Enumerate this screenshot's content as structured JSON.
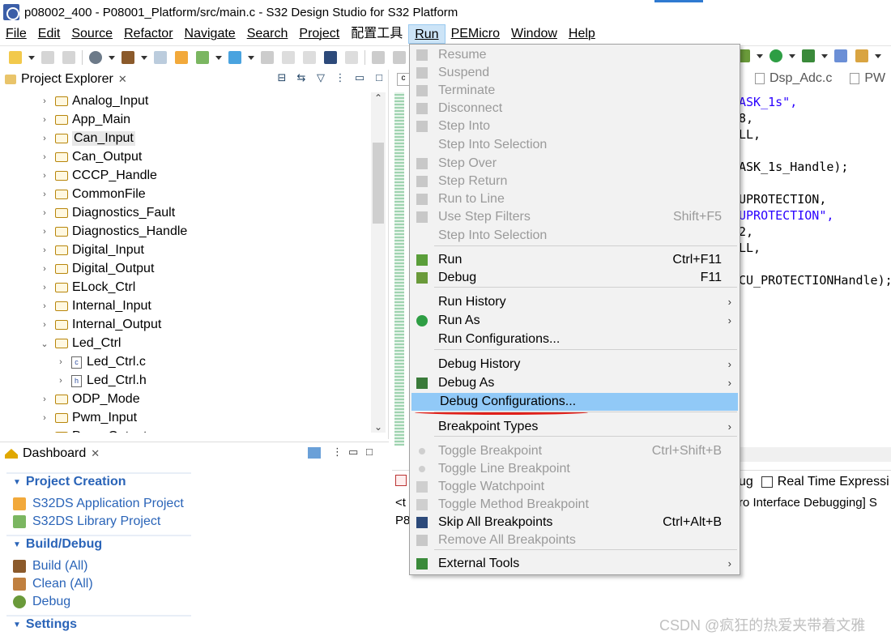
{
  "window": {
    "title": "p08002_400 - P08001_Platform/src/main.c - S32 Design Studio for S32 Platform"
  },
  "menubar": [
    "File",
    "Edit",
    "Source",
    "Refactor",
    "Navigate",
    "Search",
    "Project",
    "配置工具",
    "Run",
    "PEMicro",
    "Window",
    "Help"
  ],
  "project_explorer": {
    "title": "Project Explorer",
    "close": "✕",
    "items": [
      {
        "label": "Analog_Input",
        "type": "folder",
        "expanded": false
      },
      {
        "label": "App_Main",
        "type": "folder",
        "expanded": false
      },
      {
        "label": "Can_Input",
        "type": "folder",
        "expanded": false,
        "selected": true
      },
      {
        "label": "Can_Output",
        "type": "folder",
        "expanded": false
      },
      {
        "label": "CCCP_Handle",
        "type": "folder",
        "expanded": false
      },
      {
        "label": "CommonFile",
        "type": "folder",
        "expanded": false
      },
      {
        "label": "Diagnostics_Fault",
        "type": "folder",
        "expanded": false
      },
      {
        "label": "Diagnostics_Handle",
        "type": "folder",
        "expanded": false
      },
      {
        "label": "Digital_Input",
        "type": "folder",
        "expanded": false
      },
      {
        "label": "Digital_Output",
        "type": "folder",
        "expanded": false
      },
      {
        "label": "ELock_Ctrl",
        "type": "folder",
        "expanded": false
      },
      {
        "label": "Internal_Input",
        "type": "folder",
        "expanded": false
      },
      {
        "label": "Internal_Output",
        "type": "folder",
        "expanded": false
      },
      {
        "label": "Led_Ctrl",
        "type": "folder",
        "expanded": true
      },
      {
        "label": "Led_Ctrl.c",
        "type": "file-c",
        "child": true
      },
      {
        "label": "Led_Ctrl.h",
        "type": "file-h",
        "child": true
      },
      {
        "label": "ODP_Mode",
        "type": "folder",
        "expanded": false
      },
      {
        "label": "Pwm_Input",
        "type": "folder",
        "expanded": false
      },
      {
        "label": "Pwm_Output",
        "type": "folder",
        "expanded": false
      }
    ]
  },
  "dashboard": {
    "title": "Dashboard",
    "close": "✕",
    "sections": [
      {
        "title": "Project Creation",
        "links": [
          "S32DS Application Project",
          "S32DS Library Project"
        ]
      },
      {
        "title": "Build/Debug",
        "links": [
          "Build  (All)",
          "Clean  (All)",
          "Debug"
        ]
      },
      {
        "title": "Settings",
        "links": []
      }
    ]
  },
  "editor": {
    "tabs_right": [
      "Dsp_Adc.c",
      "PW"
    ],
    "code_lines": [
      {
        "text": "ASK_1s\",",
        "str": true
      },
      {
        "text": "8,",
        "str": false
      },
      {
        "text": "LL,",
        "str": false
      },
      {
        "text": "",
        "str": false
      },
      {
        "text": "ASK_1s_Handle);",
        "str": false
      },
      {
        "text": "",
        "str": false
      },
      {
        "text": "UPROTECTION,",
        "str": false
      },
      {
        "text": "UPROTECTION\",",
        "str": true
      },
      {
        "text": "2,",
        "str": false
      },
      {
        "text": "LL,",
        "str": false
      },
      {
        "text": "",
        "str": false
      },
      {
        "text": "CU_PROTECTIONHandle);",
        "str": false
      }
    ]
  },
  "console": {
    "tab_fragment": "ug",
    "tab_real_time": "Real Time Expressi",
    "line1_left": "<t",
    "line1_right": "ro Interface Debugging] S",
    "line2": "P8"
  },
  "run_menu": {
    "items": [
      {
        "label": "Resume",
        "accel": "",
        "disabled": true,
        "icon": "resume-icon"
      },
      {
        "label": "Suspend",
        "accel": "",
        "disabled": true,
        "icon": "suspend-icon"
      },
      {
        "label": "Terminate",
        "accel": "",
        "disabled": true,
        "icon": "terminate-icon"
      },
      {
        "label": "Disconnect",
        "accel": "",
        "disabled": true,
        "icon": "disconnect-icon"
      },
      {
        "label": "Step Into",
        "accel": "",
        "disabled": true,
        "icon": "step-into-icon"
      },
      {
        "label": "Step Into Selection",
        "accel": "",
        "disabled": true,
        "icon": ""
      },
      {
        "label": "Step Over",
        "accel": "",
        "disabled": true,
        "icon": "step-over-icon"
      },
      {
        "label": "Step Return",
        "accel": "",
        "disabled": true,
        "icon": "step-return-icon"
      },
      {
        "label": "Run to Line",
        "accel": "",
        "disabled": true,
        "icon": "run-to-line-icon"
      },
      {
        "label": "Use Step Filters",
        "accel": "Shift+F5",
        "disabled": true,
        "icon": "step-filters-icon"
      },
      {
        "label": "Step Into Selection",
        "accel": "",
        "disabled": true,
        "icon": ""
      },
      {
        "label": "Run",
        "accel": "Ctrl+F11",
        "disabled": false,
        "icon": "run-icon"
      },
      {
        "label": "Debug",
        "accel": "F11",
        "disabled": false,
        "icon": "debug-icon"
      },
      {
        "label": "Run History",
        "accel": "",
        "disabled": false,
        "icon": "",
        "submenu": true
      },
      {
        "label": "Run As",
        "accel": "",
        "disabled": false,
        "icon": "run-as-icon",
        "submenu": true
      },
      {
        "label": "Run Configurations...",
        "accel": "",
        "disabled": false,
        "icon": ""
      },
      {
        "label": "Debug History",
        "accel": "",
        "disabled": false,
        "icon": "",
        "submenu": true
      },
      {
        "label": "Debug As",
        "accel": "",
        "disabled": false,
        "icon": "debug-as-icon",
        "submenu": true
      },
      {
        "label": "Debug Configurations...",
        "accel": "",
        "disabled": false,
        "icon": "",
        "highlighted": true
      },
      {
        "label": "Breakpoint Types",
        "accel": "",
        "disabled": false,
        "icon": "",
        "submenu": true
      },
      {
        "label": "Toggle Breakpoint",
        "accel": "Ctrl+Shift+B",
        "disabled": true,
        "icon": "toggle-breakpoint-icon"
      },
      {
        "label": "Toggle Line Breakpoint",
        "accel": "",
        "disabled": true,
        "icon": "toggle-line-breakpoint-icon"
      },
      {
        "label": "Toggle Watchpoint",
        "accel": "",
        "disabled": true,
        "icon": "toggle-watchpoint-icon"
      },
      {
        "label": "Toggle Method Breakpoint",
        "accel": "",
        "disabled": true,
        "icon": "toggle-method-breakpoint-icon"
      },
      {
        "label": "Skip All Breakpoints",
        "accel": "Ctrl+Alt+B",
        "disabled": false,
        "icon": "skip-breakpoints-icon"
      },
      {
        "label": "Remove All Breakpoints",
        "accel": "",
        "disabled": true,
        "icon": "remove-breakpoints-icon"
      },
      {
        "label": "External Tools",
        "accel": "",
        "disabled": false,
        "icon": "external-tools-icon",
        "submenu": true
      }
    ],
    "submenu_arrow": "›"
  },
  "watermark": "CSDN @疯狂的热爱夹带着文雅",
  "colors": {
    "menu_highlight": "#91c9f7",
    "link_blue": "#2a64b8",
    "annotation_red": "#e0201a"
  }
}
